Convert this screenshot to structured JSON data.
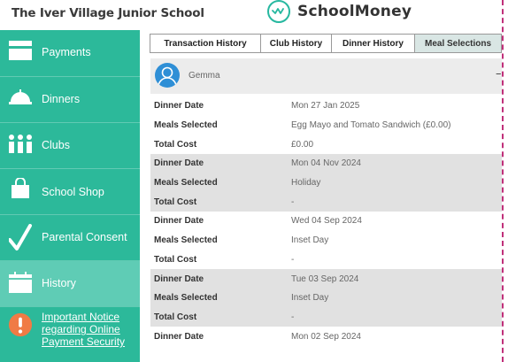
{
  "header": {
    "school_name": "The Iver Village Junior School",
    "brand": "SchoolMoney",
    "brand_color": "#27b8a0"
  },
  "sidebar": {
    "color": "#2cb99a",
    "active_color": "#5fccb5",
    "items": [
      {
        "label": "Payments",
        "icon": "card-icon"
      },
      {
        "label": "Dinners",
        "icon": "cloche-icon"
      },
      {
        "label": "Clubs",
        "icon": "people-icon"
      },
      {
        "label": "School Shop",
        "icon": "shopping-bag-icon"
      },
      {
        "label": "Parental Consent",
        "icon": "checkmark-icon"
      },
      {
        "label": "History",
        "icon": "calendar-icon"
      },
      {
        "label": "Important Notice regarding Online Payment Security",
        "icon": "alert-icon"
      }
    ],
    "active_index": 5
  },
  "tabs": [
    {
      "label": "Transaction History"
    },
    {
      "label": "Club History"
    },
    {
      "label": "Dinner History"
    },
    {
      "label": "Meal Selections"
    }
  ],
  "active_tab": "Meal Selections",
  "child": {
    "name": "Gemma",
    "collapse_symbol": "–"
  },
  "records": [
    {
      "rows": [
        {
          "label": "Dinner Date",
          "value": "Mon 27 Jan 2025"
        },
        {
          "label": "Meals Selected",
          "value": "Egg Mayo and Tomato Sandwich (£0.00)"
        },
        {
          "label": "Total Cost",
          "value": "£0.00"
        }
      ]
    },
    {
      "rows": [
        {
          "label": "Dinner Date",
          "value": "Mon 04 Nov 2024"
        },
        {
          "label": "Meals Selected",
          "value": "Holiday"
        },
        {
          "label": "Total Cost",
          "value": "-"
        }
      ]
    },
    {
      "rows": [
        {
          "label": "Dinner Date",
          "value": "Wed 04 Sep 2024"
        },
        {
          "label": "Meals Selected",
          "value": "Inset Day"
        },
        {
          "label": "Total Cost",
          "value": "-"
        }
      ]
    },
    {
      "rows": [
        {
          "label": "Dinner Date",
          "value": "Tue 03 Sep 2024"
        },
        {
          "label": "Meals Selected",
          "value": "Inset Day"
        },
        {
          "label": "Total Cost",
          "value": "-"
        }
      ]
    },
    {
      "rows": [
        {
          "label": "Dinner Date",
          "value": "Mon 02 Sep 2024"
        }
      ]
    }
  ]
}
